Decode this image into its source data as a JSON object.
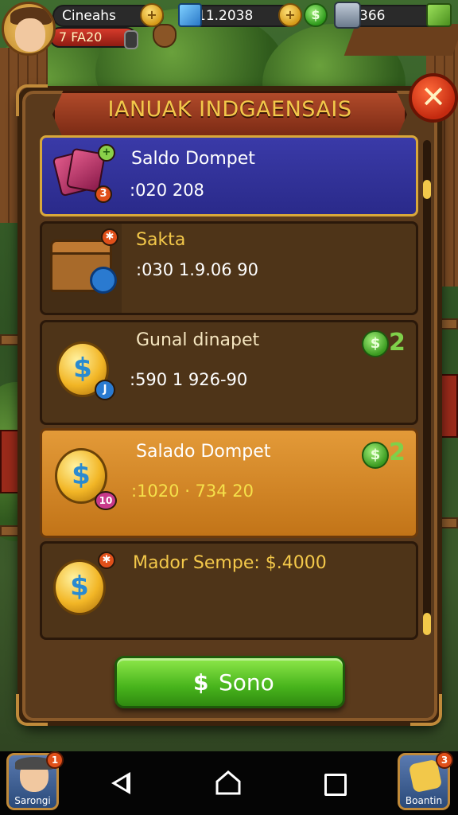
{
  "hud": {
    "player_name": "Cineahs",
    "player_level": "7 FA20",
    "cube_value": "11.2038",
    "gem_value": "366"
  },
  "dialog": {
    "title": "IANUAK INDGAENSAIS",
    "close_icon": "close-icon"
  },
  "list": {
    "items": [
      {
        "name": "Saldo Dompet",
        "value": ":020  208",
        "badge": "3",
        "selected": true
      },
      {
        "name": "Sakta",
        "value": ":030  1.9.06 90"
      },
      {
        "name": "Gunal dinapet",
        "value": ":590  1 926-90",
        "reward": "2",
        "badge": "J"
      },
      {
        "name": "Salado Dompet",
        "value": ":1020 · 734 20",
        "reward": "2",
        "badge": "10"
      },
      {
        "name": "Mador Sempe: $.4000"
      }
    ]
  },
  "action": {
    "label": "Sono",
    "icon": "$"
  },
  "bottom": {
    "left_label": "Sarongi",
    "left_badge": "1",
    "right_label": "Boantin",
    "right_badge": "3"
  },
  "colors": {
    "selected_row": "#2a2a8a",
    "highlight_row": "#e39a38",
    "title_text": "#f3c84a",
    "action_green": "#48b41c"
  }
}
